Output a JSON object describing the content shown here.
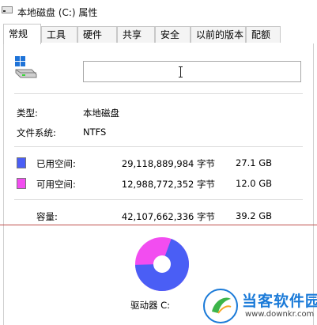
{
  "window": {
    "title": "本地磁盘 (C:) 属性"
  },
  "tabs": [
    {
      "label": "常规",
      "active": true
    },
    {
      "label": "工具"
    },
    {
      "label": "硬件"
    },
    {
      "label": "共享"
    },
    {
      "label": "安全"
    },
    {
      "label": "以前的版本"
    },
    {
      "label": "配额"
    }
  ],
  "general": {
    "name_value": "",
    "type_label": "类型:",
    "type_value": "本地磁盘",
    "fs_label": "文件系统:",
    "fs_value": "NTFS",
    "used": {
      "label": "已用空间:",
      "bytes": "29,118,889,984 字节",
      "size": "27.1 GB",
      "color": "#4a5ef5"
    },
    "free": {
      "label": "可用空间:",
      "bytes": "12,988,772,352 字节",
      "size": "12.0 GB",
      "color": "#f24df0"
    },
    "capacity": {
      "label": "容量:",
      "bytes": "42,107,662,336 字节",
      "size": "39.2 GB"
    },
    "drive_label": "驱动器 C:",
    "used_fraction": 0.69
  },
  "watermark": {
    "text": "当客软件园",
    "url": "www.downkr.com"
  },
  "icons": {
    "app": "drive-icon",
    "drive": "hard-drive-icon",
    "caret": "text-cursor-icon",
    "watermark": "watermark-logo-icon"
  }
}
